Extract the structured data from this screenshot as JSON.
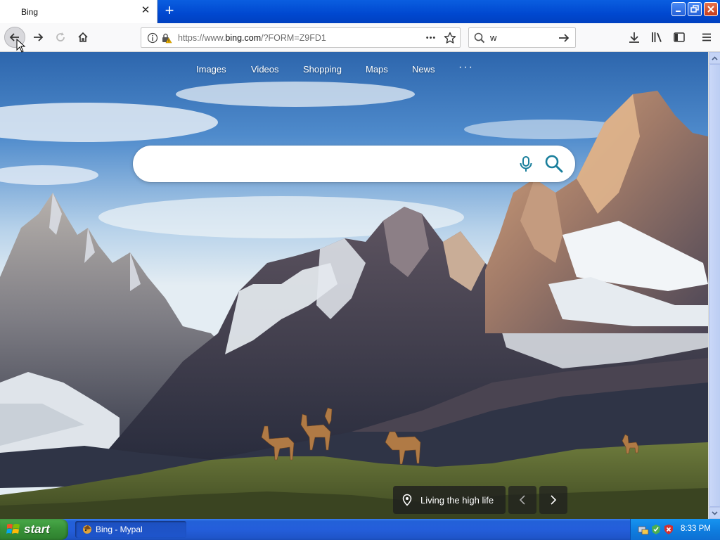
{
  "browser": {
    "tab_title": "Bing",
    "url_prefix": "https://www.",
    "url_domain": "bing.com",
    "url_suffix": "/?FORM=Z9FD1",
    "search_bar_value": "w",
    "page_actions_label": "•••"
  },
  "bing": {
    "nav_links": [
      "Images",
      "Videos",
      "Shopping",
      "Maps",
      "News"
    ],
    "more_label": "···",
    "search_placeholder": "",
    "image_caption": "Living the high life"
  },
  "taskbar": {
    "start_label": "start",
    "task_label": "Bing - Mypal",
    "clock": "8:33 PM"
  },
  "icons": {
    "back": "back-arrow-icon",
    "forward": "forward-arrow-icon",
    "reload": "reload-icon",
    "home": "home-icon",
    "info": "info-icon",
    "lock": "lock-warning-icon",
    "bookmark": "star-icon",
    "search": "magnifier-icon",
    "go": "arrow-right-icon",
    "downloads": "download-icon",
    "library": "library-icon",
    "sidebar": "sidebar-icon",
    "menu": "hamburger-menu-icon",
    "microphone": "microphone-icon",
    "location": "location-pin-icon"
  },
  "colors": {
    "bing_teal": "#1a7f9c",
    "taskbar_blue": "#245edb",
    "start_green": "#399339"
  }
}
